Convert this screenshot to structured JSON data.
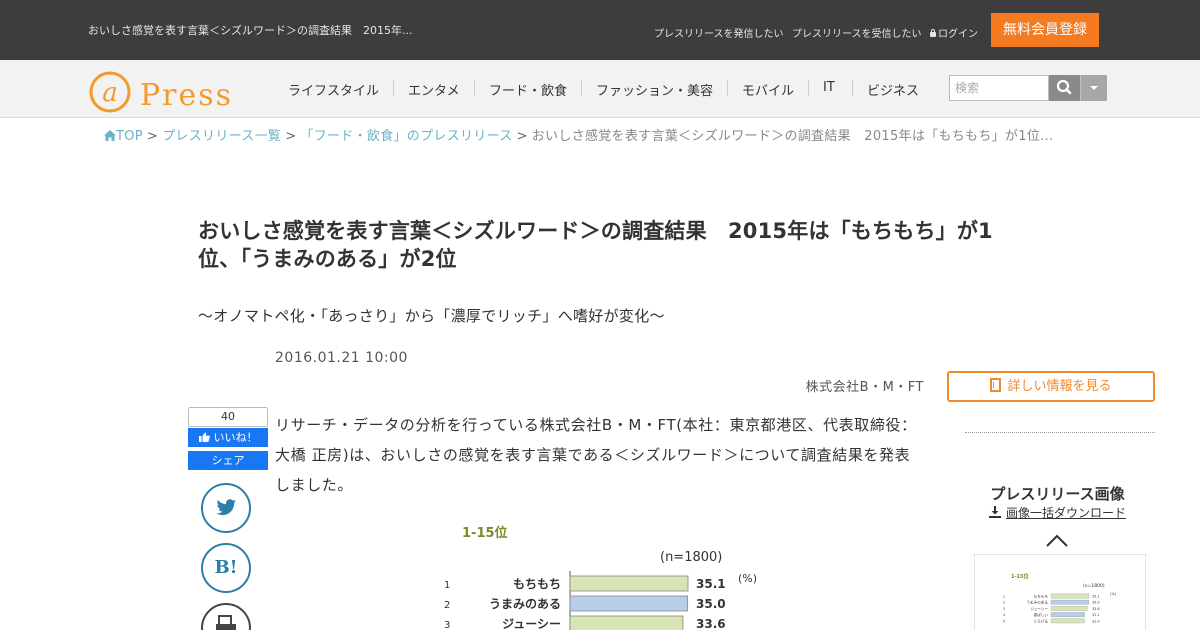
{
  "topbar": {
    "page_title": "おいしさ感覚を表す言葉＜シズルワード＞の調査結果　2015年...",
    "links": [
      "プレスリリースを発信したい",
      "プレスリリースを受信したい",
      "ログイン"
    ],
    "register_label": "無料会員登録"
  },
  "nav": {
    "logo_text": "Press",
    "items": [
      "ライフスタイル",
      "エンタメ",
      "フード・飲食",
      "ファッション・美容",
      "モバイル",
      "IT",
      "ビジネス"
    ],
    "search_placeholder": "検索"
  },
  "breadcrumb": {
    "top": "TOP",
    "list": "プレスリリース一覧",
    "category": "「フード・飲食」のプレスリリース",
    "current": "おいしさ感覚を表す言葉＜シズルワード＞の調査結果　2015年は「もちもち」が1位..."
  },
  "article": {
    "title": "おいしさ感覚を表す言葉＜シズルワード＞の調査結果　2015年は「もちもち」が1位、「うまみのある」が2位",
    "subtitle": "～オノマトペ化・「あっさり」から「濃厚でリッチ」へ嗜好が変化～",
    "date": "2016.01.21 10:00",
    "company": "株式会社B・M・FT",
    "detail_button": "詳しい情報を見る",
    "body": "リサーチ・データの分析を行っている株式会社B・M・FT(本社：東京都港区、代表取締役：大橋 正房)は、おいしさの感覚を表す言葉である＜シズルワード＞について調査結果を発表しました。"
  },
  "social": {
    "like_count": "40",
    "like_label": "いいね！",
    "share_label": "シェア",
    "hatena_label": "B!"
  },
  "sidebar": {
    "title": "プレスリリース画像",
    "download_label": "画像一括ダウンロード"
  },
  "chart_data": {
    "type": "bar",
    "title": "1-15位",
    "note": "(n=1800)",
    "unit": "(%)",
    "ranks": [
      "1",
      "2",
      "3"
    ],
    "categories": [
      "もちもち",
      "うまみのある",
      "ジューシー"
    ],
    "values": [
      35.1,
      35.0,
      33.6
    ],
    "colors": [
      "#d7e4b4",
      "#b9cde6",
      "#d7e4b4"
    ],
    "accent": "#7a8a2a",
    "thumb": {
      "ranks": [
        "1",
        "2",
        "3",
        "4",
        "5"
      ],
      "categories": [
        "もちもち",
        "うまみのある",
        "ジューシー",
        "香ばしい",
        "とろける"
      ],
      "values": [
        35.1,
        35.0,
        33.6,
        31.1,
        31.0
      ]
    }
  },
  "colors": {
    "topbar": "#3d3d3d",
    "brand_orange": "#f47b1f",
    "link": "#6bb3c9",
    "facebook": "#1877f2",
    "twitter": "#2b7ea8"
  }
}
